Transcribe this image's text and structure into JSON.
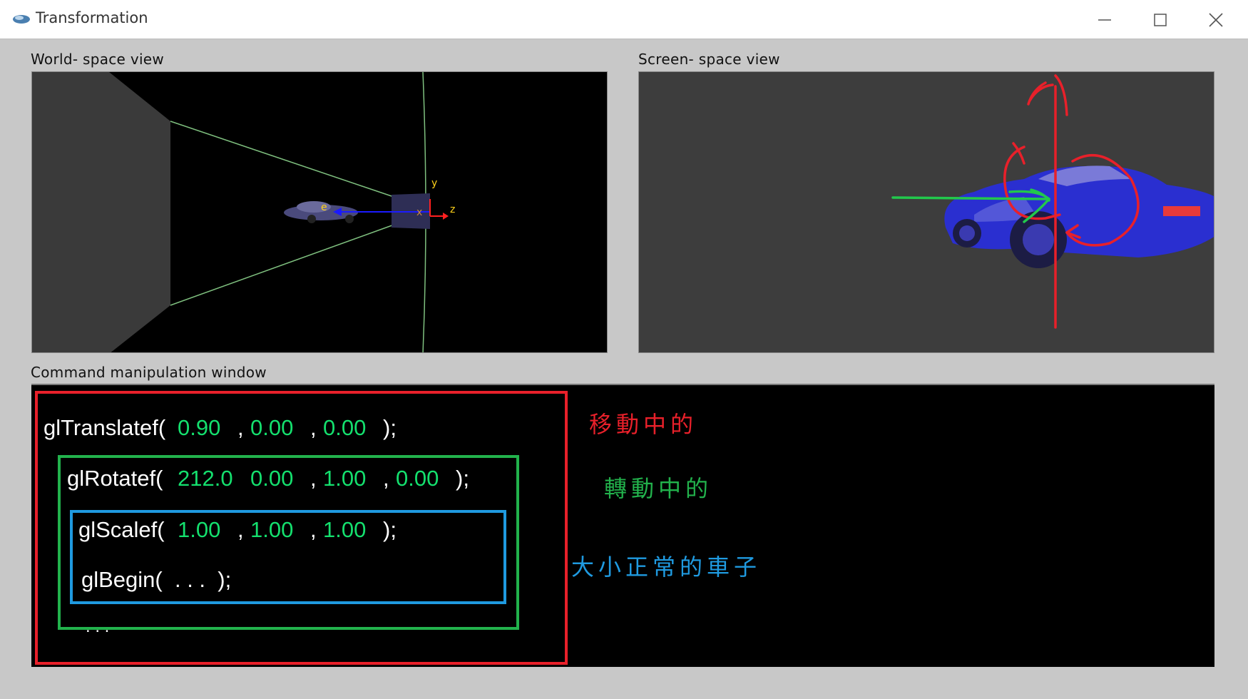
{
  "window": {
    "title": "Transformation"
  },
  "world_view": {
    "label": "World- space view",
    "axis_y": "y",
    "axis_z": "z",
    "axis_x": "x",
    "eye": "e"
  },
  "screen_view": {
    "label": "Screen- space view"
  },
  "command_window": {
    "label": "Command manipulation window",
    "translate": {
      "fn": "glTranslatef(",
      "args": [
        "0.90",
        "0.00",
        "0.00"
      ],
      "close": ");"
    },
    "rotate": {
      "fn": "glRotatef(",
      "args": [
        "212.0",
        "0.00",
        "1.00",
        "0.00"
      ],
      "close": ");"
    },
    "scale": {
      "fn": "glScalef(",
      "args": [
        "1.00",
        "1.00",
        "1.00"
      ],
      "close": ");"
    },
    "begin": {
      "text": "glBegin(  . . .  );"
    },
    "ellipsis": ". . ."
  },
  "annotations": {
    "translate_note": "移動中的",
    "rotate_note": "轉動中的",
    "scale_note": "大小正常的車子"
  },
  "colors": {
    "translate_box": "#e8202a",
    "rotate_box": "#22b24c",
    "scale_box": "#1f9ae0",
    "value_green": "#14e06e",
    "car_blue": "#2a2fd0"
  }
}
